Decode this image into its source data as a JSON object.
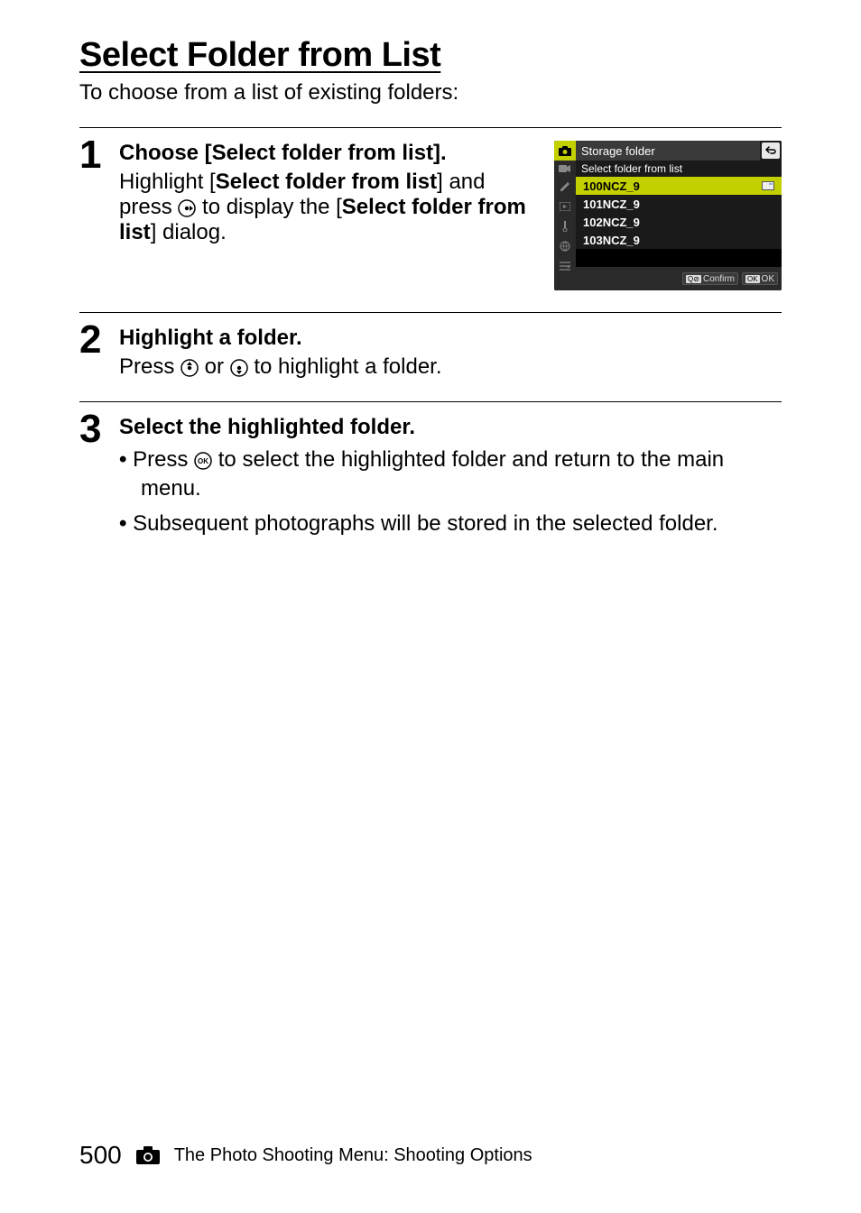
{
  "title": "Select Folder from List",
  "subtitle": "To choose from a list of existing folders:",
  "steps": {
    "s1": {
      "num": "1",
      "head": "Choose [Select folder from list].",
      "text_pre": "Highlight [",
      "text_bold1": "Select folder from list",
      "text_mid": "] and press ",
      "text_post": " to display the [",
      "text_bold2": "Select folder from list",
      "text_end": "] dialog."
    },
    "s2": {
      "num": "2",
      "head": "Highlight a folder.",
      "text_pre": "Press ",
      "text_mid": " or ",
      "text_end": " to highlight a folder."
    },
    "s3": {
      "num": "3",
      "head": "Select the highlighted folder.",
      "b1_pre": "Press ",
      "b1_post": " to select the highlighted folder and return to the main menu.",
      "b2": "Subsequent photographs will be stored in the selected folder."
    }
  },
  "menu": {
    "title": "Storage folder",
    "subtitle": "Select folder from list",
    "folders": [
      "100NCZ_9",
      "101NCZ_9",
      "102NCZ_9",
      "103NCZ_9"
    ],
    "confirm": "Confirm",
    "ok": "OK",
    "confirm_tag": "Q⊘",
    "ok_tag": "OK"
  },
  "footer": {
    "page": "500",
    "text": "The Photo Shooting Menu: Shooting Options"
  }
}
